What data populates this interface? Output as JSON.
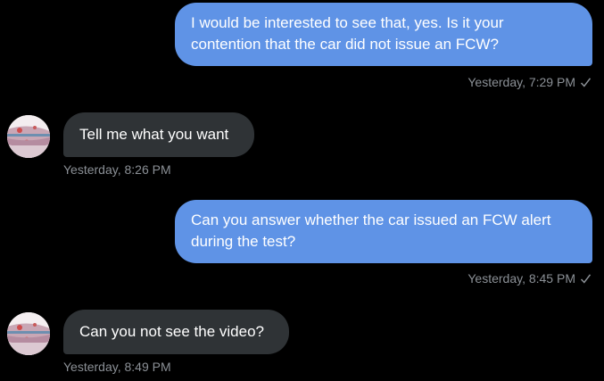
{
  "messages": [
    {
      "direction": "out",
      "text": "I would be interested to see that, yes. Is it your contention that the car did not issue an FCW?",
      "timestamp": "Yesterday, 7:29 PM",
      "status_icon": "check-icon"
    },
    {
      "direction": "in",
      "text": "Tell me what you want",
      "timestamp": "Yesterday, 8:26 PM"
    },
    {
      "direction": "out",
      "text": "Can you answer whether the car issued an FCW alert during the test?",
      "timestamp": "Yesterday, 8:45 PM",
      "status_icon": "check-icon"
    },
    {
      "direction": "in",
      "text": "Can you not see the video?",
      "timestamp": "Yesterday, 8:49 PM"
    }
  ],
  "colors": {
    "background": "#000000",
    "outgoing_bubble": "#5f93e6",
    "incoming_bubble": "#2f3336",
    "timestamp": "#8b9096"
  }
}
